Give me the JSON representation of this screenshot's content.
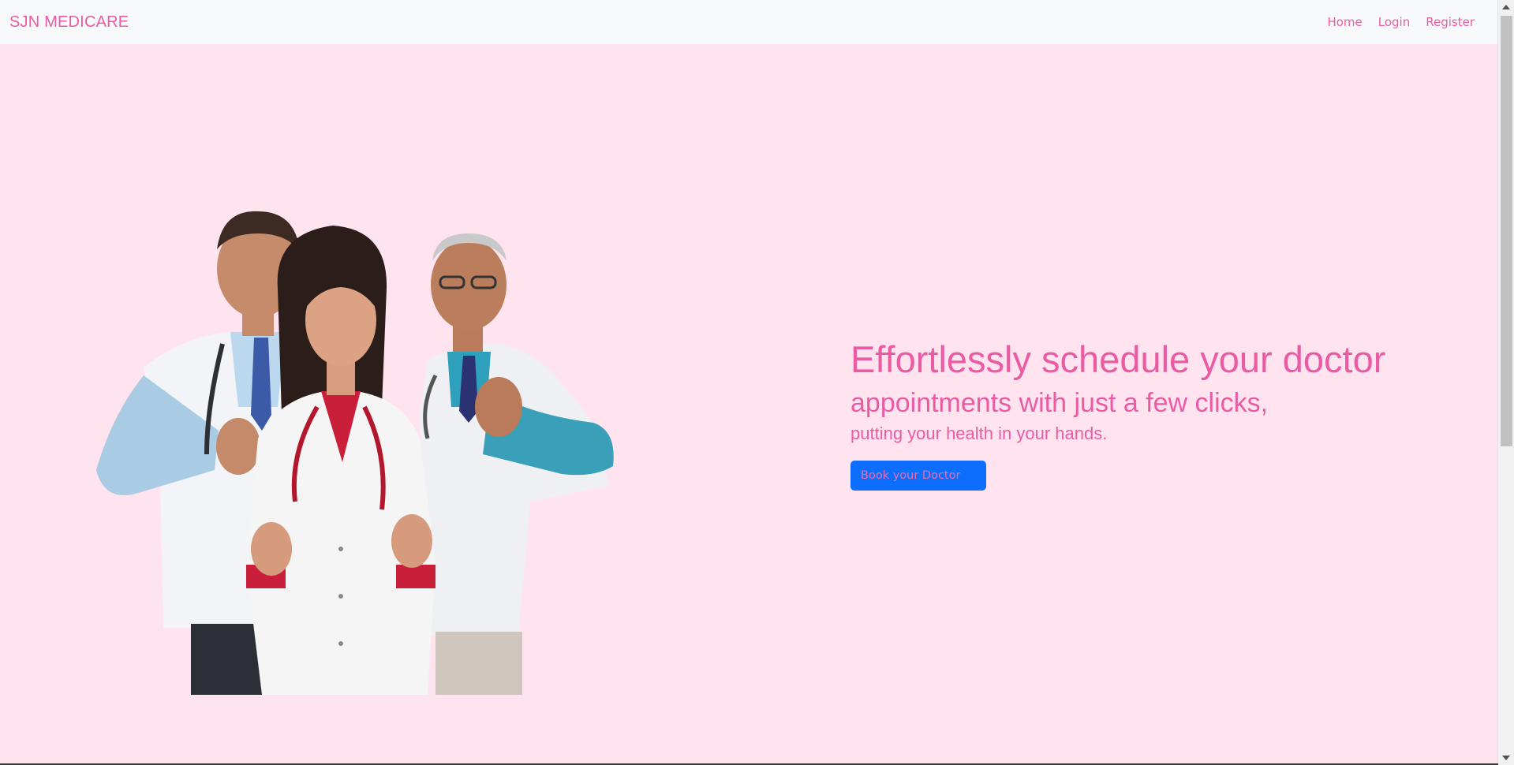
{
  "navbar": {
    "brand": "SJN MEDICARE",
    "links": [
      "Home",
      "Login",
      "Register"
    ]
  },
  "hero": {
    "headline_line1": "Effortlessly schedule your doctor",
    "headline_line2": "appointments with just a few clicks,",
    "headline_line3": "putting your health in your hands.",
    "cta_label": "Book your Doctor",
    "image_icon": "three-doctors-thumbs-up-image"
  },
  "colors": {
    "accent": "#ea5ba3",
    "background": "#ffe4f0",
    "navbar_bg": "#f8f9fa",
    "button_bg": "#0d6efd"
  }
}
